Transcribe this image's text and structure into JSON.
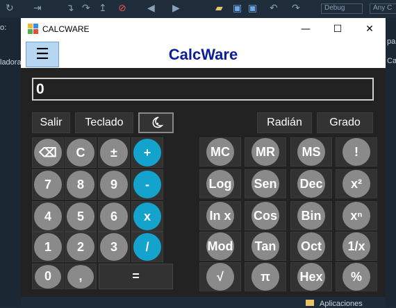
{
  "ide": {
    "left_labels": [
      "o:",
      "ladora"
    ],
    "right_labels": [
      "Cal",
      "pa"
    ],
    "toolbar_dropdown1": "Debug",
    "toolbar_dropdown2": "Any C",
    "bottom_item": "Aplicaciones"
  },
  "window": {
    "title": "CALCWARE",
    "minimize_glyph": "—",
    "maximize_glyph": "☐",
    "close_glyph": "✕",
    "icon_colors": [
      "#f2b733",
      "#3b8ee8",
      "#4caf50",
      "#e84a3b"
    ]
  },
  "header": {
    "menu_glyph": "☰",
    "title": "CalcWare",
    "title_color": "#0b1e9a"
  },
  "display": {
    "value": "0"
  },
  "top_buttons": {
    "salir": "Salir",
    "teclado": "Teclado",
    "theme_icon": "moon-icon",
    "radian": "Radián",
    "grado": "Grado"
  },
  "keypad": {
    "row1": [
      "⌫",
      "C",
      "±",
      "+"
    ],
    "row2": [
      "7",
      "8",
      "9",
      "-"
    ],
    "row3": [
      "4",
      "5",
      "6",
      "x"
    ],
    "row4": [
      "1",
      "2",
      "3",
      "/"
    ],
    "row5": [
      "0",
      ",",
      "="
    ]
  },
  "scientific": {
    "row1": [
      "MC",
      "MR",
      "MS",
      "!"
    ],
    "row2": [
      "Log",
      "Sen",
      "Dec",
      "x²"
    ],
    "row3": [
      "In x",
      "Cos",
      "Bin",
      "xⁿ"
    ],
    "row4": [
      "Mod",
      "Tan",
      "Oct",
      "1/x"
    ],
    "row5": [
      "√",
      "π",
      "Hex",
      "%"
    ]
  },
  "colors": {
    "accent_blue": "#14a3cc",
    "key_gray": "#8a8a8a",
    "panel": "#222222"
  }
}
